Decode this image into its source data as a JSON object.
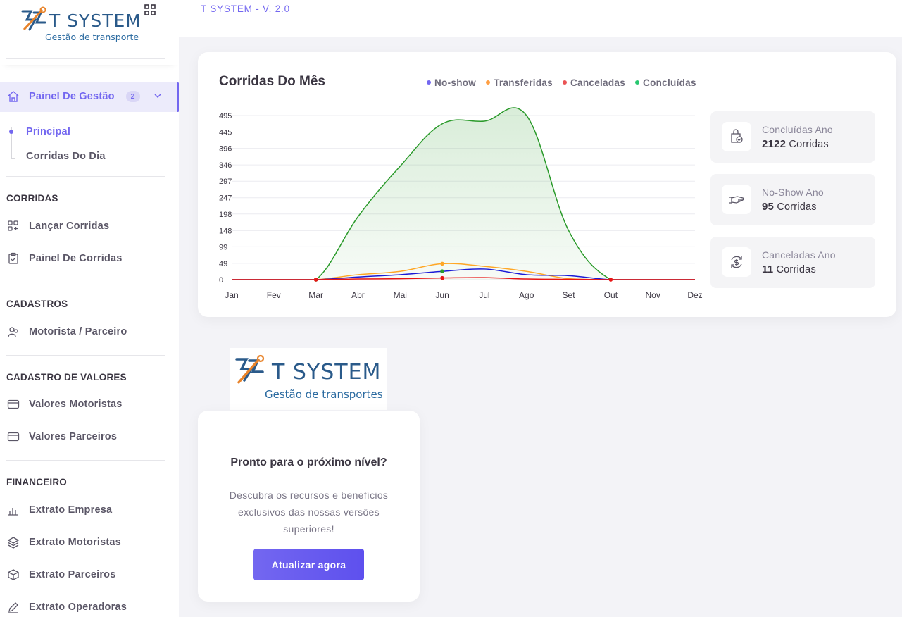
{
  "app": {
    "logo_name": "T SYSTEM",
    "logo_tagline": "Gestão de transportes",
    "version": "T SYSTEM - V. 2.0"
  },
  "sidebar": {
    "dashboard": {
      "label": "Painel De Gestão",
      "badge": "2"
    },
    "sub_items": [
      {
        "label": "Principal"
      },
      {
        "label": "Corridas Do Dia"
      }
    ],
    "sections": [
      {
        "title": "CORRIDAS",
        "items": [
          {
            "label": "Lançar Corridas",
            "icon": "grid-plus-icon"
          },
          {
            "label": "Painel De Corridas",
            "icon": "clipboard-icon"
          }
        ]
      },
      {
        "title": "CADASTROS",
        "items": [
          {
            "label": "Motorista / Parceiro",
            "icon": "users-icon"
          }
        ]
      },
      {
        "title": "CADASTRO DE VALORES",
        "items": [
          {
            "label": "Valores Motoristas",
            "icon": "card-icon"
          },
          {
            "label": "Valores Parceiros",
            "icon": "card-icon"
          }
        ]
      },
      {
        "title": "FINANCEIRO",
        "items": [
          {
            "label": "Extrato Empresa",
            "icon": "bar-chart-icon"
          },
          {
            "label": "Extrato Motoristas",
            "icon": "layers-icon"
          },
          {
            "label": "Extrato Parceiros",
            "icon": "box-icon"
          },
          {
            "label": "Extrato Operadoras",
            "icon": "pen-icon"
          }
        ]
      }
    ]
  },
  "chart_card": {
    "title": "Corridas Do Mês",
    "legend": [
      {
        "label": "No-show",
        "color": "#7367f0"
      },
      {
        "label": "Transferidas",
        "color": "#ff9f43"
      },
      {
        "label": "Canceladas",
        "color": "#ea5455"
      },
      {
        "label": "Concluídas",
        "color": "#28c76f"
      }
    ]
  },
  "chart_data": {
    "type": "area",
    "categories": [
      "Jan",
      "Fev",
      "Mar",
      "Abr",
      "Mai",
      "Jun",
      "Jul",
      "Ago",
      "Set",
      "Out",
      "Nov",
      "Dez"
    ],
    "y_ticks": [
      "495",
      "445",
      "396",
      "346",
      "297",
      "247",
      "198",
      "148",
      "99",
      "49",
      "0"
    ],
    "ylim": [
      0,
      495
    ],
    "series": [
      {
        "name": "No-show",
        "color": "#1a1ad6",
        "values": [
          0,
          0,
          0,
          8,
          15,
          25,
          32,
          15,
          12,
          0,
          0,
          0
        ]
      },
      {
        "name": "Transferidas",
        "color": "#ffa726",
        "values": [
          0,
          0,
          0,
          15,
          25,
          48,
          40,
          25,
          3,
          0,
          0,
          0
        ]
      },
      {
        "name": "Canceladas",
        "color": "#e81515",
        "values": [
          0,
          0,
          0,
          2,
          3,
          5,
          6,
          2,
          1,
          0,
          0,
          0
        ]
      },
      {
        "name": "Concluídas",
        "color": "#2a9a2a",
        "values": [
          0,
          0,
          0,
          190,
          342,
          470,
          478,
          495,
          148,
          0,
          0,
          0
        ]
      }
    ],
    "grid": true
  },
  "stats": [
    {
      "label": "Concluídas Ano",
      "value": "2122",
      "unit": "Corridas",
      "icon": "bag-check-icon"
    },
    {
      "label": "No-Show Ano",
      "value": "95",
      "unit": "Corridas",
      "icon": "hand-icon"
    },
    {
      "label": "Canceladas Ano",
      "value": "11",
      "unit": "Corridas",
      "icon": "dollar-refresh-icon"
    }
  ],
  "promo": {
    "title": "Pronto para o próximo nível?",
    "text": "Descubra os recursos e benefícios exclusivos das nossas versões superiores!",
    "button": "Atualizar agora"
  }
}
